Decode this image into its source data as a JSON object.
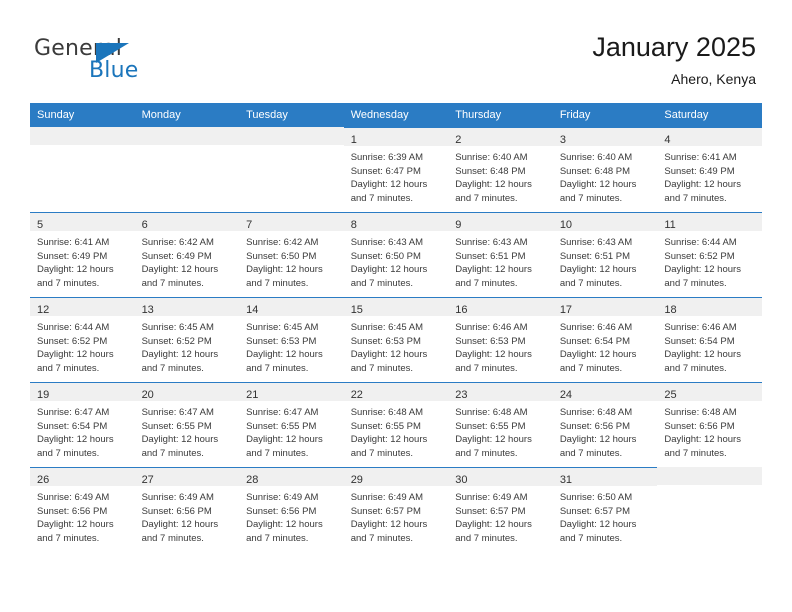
{
  "brand": {
    "name_top": "General",
    "name_bottom": "Blue",
    "color_text": "#3b3b3b",
    "color_accent": "#1b75bb"
  },
  "header": {
    "title": "January 2025",
    "subtitle": "Ahero, Kenya"
  },
  "theme": {
    "header_row_bg": "#2b7cc4",
    "daynum_band_bg": "#f0f0f0",
    "cell_border_top": "#2b7cc4",
    "text": "#3a3a3a"
  },
  "weekdays": [
    "Sunday",
    "Monday",
    "Tuesday",
    "Wednesday",
    "Thursday",
    "Friday",
    "Saturday"
  ],
  "labels": {
    "sunrise_prefix": "Sunrise:",
    "sunset_prefix": "Sunset:",
    "daylight_prefix": "Daylight:"
  },
  "weeks": [
    [
      {
        "day": "",
        "empty": true,
        "sunrise": "",
        "sunset": "",
        "daylight_line1": "",
        "daylight_line2": ""
      },
      {
        "day": "",
        "empty": true,
        "sunrise": "",
        "sunset": "",
        "daylight_line1": "",
        "daylight_line2": ""
      },
      {
        "day": "",
        "empty": true,
        "sunrise": "",
        "sunset": "",
        "daylight_line1": "",
        "daylight_line2": ""
      },
      {
        "day": "1",
        "empty": false,
        "sunrise": "Sunrise: 6:39 AM",
        "sunset": "Sunset: 6:47 PM",
        "daylight_line1": "Daylight: 12 hours",
        "daylight_line2": "and 7 minutes."
      },
      {
        "day": "2",
        "empty": false,
        "sunrise": "Sunrise: 6:40 AM",
        "sunset": "Sunset: 6:48 PM",
        "daylight_line1": "Daylight: 12 hours",
        "daylight_line2": "and 7 minutes."
      },
      {
        "day": "3",
        "empty": false,
        "sunrise": "Sunrise: 6:40 AM",
        "sunset": "Sunset: 6:48 PM",
        "daylight_line1": "Daylight: 12 hours",
        "daylight_line2": "and 7 minutes."
      },
      {
        "day": "4",
        "empty": false,
        "sunrise": "Sunrise: 6:41 AM",
        "sunset": "Sunset: 6:49 PM",
        "daylight_line1": "Daylight: 12 hours",
        "daylight_line2": "and 7 minutes."
      }
    ],
    [
      {
        "day": "5",
        "empty": false,
        "sunrise": "Sunrise: 6:41 AM",
        "sunset": "Sunset: 6:49 PM",
        "daylight_line1": "Daylight: 12 hours",
        "daylight_line2": "and 7 minutes."
      },
      {
        "day": "6",
        "empty": false,
        "sunrise": "Sunrise: 6:42 AM",
        "sunset": "Sunset: 6:49 PM",
        "daylight_line1": "Daylight: 12 hours",
        "daylight_line2": "and 7 minutes."
      },
      {
        "day": "7",
        "empty": false,
        "sunrise": "Sunrise: 6:42 AM",
        "sunset": "Sunset: 6:50 PM",
        "daylight_line1": "Daylight: 12 hours",
        "daylight_line2": "and 7 minutes."
      },
      {
        "day": "8",
        "empty": false,
        "sunrise": "Sunrise: 6:43 AM",
        "sunset": "Sunset: 6:50 PM",
        "daylight_line1": "Daylight: 12 hours",
        "daylight_line2": "and 7 minutes."
      },
      {
        "day": "9",
        "empty": false,
        "sunrise": "Sunrise: 6:43 AM",
        "sunset": "Sunset: 6:51 PM",
        "daylight_line1": "Daylight: 12 hours",
        "daylight_line2": "and 7 minutes."
      },
      {
        "day": "10",
        "empty": false,
        "sunrise": "Sunrise: 6:43 AM",
        "sunset": "Sunset: 6:51 PM",
        "daylight_line1": "Daylight: 12 hours",
        "daylight_line2": "and 7 minutes."
      },
      {
        "day": "11",
        "empty": false,
        "sunrise": "Sunrise: 6:44 AM",
        "sunset": "Sunset: 6:52 PM",
        "daylight_line1": "Daylight: 12 hours",
        "daylight_line2": "and 7 minutes."
      }
    ],
    [
      {
        "day": "12",
        "empty": false,
        "sunrise": "Sunrise: 6:44 AM",
        "sunset": "Sunset: 6:52 PM",
        "daylight_line1": "Daylight: 12 hours",
        "daylight_line2": "and 7 minutes."
      },
      {
        "day": "13",
        "empty": false,
        "sunrise": "Sunrise: 6:45 AM",
        "sunset": "Sunset: 6:52 PM",
        "daylight_line1": "Daylight: 12 hours",
        "daylight_line2": "and 7 minutes."
      },
      {
        "day": "14",
        "empty": false,
        "sunrise": "Sunrise: 6:45 AM",
        "sunset": "Sunset: 6:53 PM",
        "daylight_line1": "Daylight: 12 hours",
        "daylight_line2": "and 7 minutes."
      },
      {
        "day": "15",
        "empty": false,
        "sunrise": "Sunrise: 6:45 AM",
        "sunset": "Sunset: 6:53 PM",
        "daylight_line1": "Daylight: 12 hours",
        "daylight_line2": "and 7 minutes."
      },
      {
        "day": "16",
        "empty": false,
        "sunrise": "Sunrise: 6:46 AM",
        "sunset": "Sunset: 6:53 PM",
        "daylight_line1": "Daylight: 12 hours",
        "daylight_line2": "and 7 minutes."
      },
      {
        "day": "17",
        "empty": false,
        "sunrise": "Sunrise: 6:46 AM",
        "sunset": "Sunset: 6:54 PM",
        "daylight_line1": "Daylight: 12 hours",
        "daylight_line2": "and 7 minutes."
      },
      {
        "day": "18",
        "empty": false,
        "sunrise": "Sunrise: 6:46 AM",
        "sunset": "Sunset: 6:54 PM",
        "daylight_line1": "Daylight: 12 hours",
        "daylight_line2": "and 7 minutes."
      }
    ],
    [
      {
        "day": "19",
        "empty": false,
        "sunrise": "Sunrise: 6:47 AM",
        "sunset": "Sunset: 6:54 PM",
        "daylight_line1": "Daylight: 12 hours",
        "daylight_line2": "and 7 minutes."
      },
      {
        "day": "20",
        "empty": false,
        "sunrise": "Sunrise: 6:47 AM",
        "sunset": "Sunset: 6:55 PM",
        "daylight_line1": "Daylight: 12 hours",
        "daylight_line2": "and 7 minutes."
      },
      {
        "day": "21",
        "empty": false,
        "sunrise": "Sunrise: 6:47 AM",
        "sunset": "Sunset: 6:55 PM",
        "daylight_line1": "Daylight: 12 hours",
        "daylight_line2": "and 7 minutes."
      },
      {
        "day": "22",
        "empty": false,
        "sunrise": "Sunrise: 6:48 AM",
        "sunset": "Sunset: 6:55 PM",
        "daylight_line1": "Daylight: 12 hours",
        "daylight_line2": "and 7 minutes."
      },
      {
        "day": "23",
        "empty": false,
        "sunrise": "Sunrise: 6:48 AM",
        "sunset": "Sunset: 6:55 PM",
        "daylight_line1": "Daylight: 12 hours",
        "daylight_line2": "and 7 minutes."
      },
      {
        "day": "24",
        "empty": false,
        "sunrise": "Sunrise: 6:48 AM",
        "sunset": "Sunset: 6:56 PM",
        "daylight_line1": "Daylight: 12 hours",
        "daylight_line2": "and 7 minutes."
      },
      {
        "day": "25",
        "empty": false,
        "sunrise": "Sunrise: 6:48 AM",
        "sunset": "Sunset: 6:56 PM",
        "daylight_line1": "Daylight: 12 hours",
        "daylight_line2": "and 7 minutes."
      }
    ],
    [
      {
        "day": "26",
        "empty": false,
        "sunrise": "Sunrise: 6:49 AM",
        "sunset": "Sunset: 6:56 PM",
        "daylight_line1": "Daylight: 12 hours",
        "daylight_line2": "and 7 minutes."
      },
      {
        "day": "27",
        "empty": false,
        "sunrise": "Sunrise: 6:49 AM",
        "sunset": "Sunset: 6:56 PM",
        "daylight_line1": "Daylight: 12 hours",
        "daylight_line2": "and 7 minutes."
      },
      {
        "day": "28",
        "empty": false,
        "sunrise": "Sunrise: 6:49 AM",
        "sunset": "Sunset: 6:56 PM",
        "daylight_line1": "Daylight: 12 hours",
        "daylight_line2": "and 7 minutes."
      },
      {
        "day": "29",
        "empty": false,
        "sunrise": "Sunrise: 6:49 AM",
        "sunset": "Sunset: 6:57 PM",
        "daylight_line1": "Daylight: 12 hours",
        "daylight_line2": "and 7 minutes."
      },
      {
        "day": "30",
        "empty": false,
        "sunrise": "Sunrise: 6:49 AM",
        "sunset": "Sunset: 6:57 PM",
        "daylight_line1": "Daylight: 12 hours",
        "daylight_line2": "and 7 minutes."
      },
      {
        "day": "31",
        "empty": false,
        "sunrise": "Sunrise: 6:50 AM",
        "sunset": "Sunset: 6:57 PM",
        "daylight_line1": "Daylight: 12 hours",
        "daylight_line2": "and 7 minutes."
      },
      {
        "day": "",
        "empty": true,
        "sunrise": "",
        "sunset": "",
        "daylight_line1": "",
        "daylight_line2": ""
      }
    ]
  ]
}
